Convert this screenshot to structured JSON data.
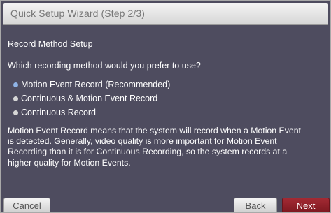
{
  "window": {
    "title": "Quick Setup Wizard (Step 2/3)"
  },
  "section": {
    "title": "Record Method Setup"
  },
  "question": "Which recording method would you prefer to use?",
  "options": [
    {
      "label": "Motion Event Record (Recommended)",
      "selected": true
    },
    {
      "label": "Continuous & Motion Event Record",
      "selected": false
    },
    {
      "label": "Continuous Record",
      "selected": false
    }
  ],
  "description": {
    "lines": [
      "Motion Event Record means that the system will record when a Motion Event",
      "is detected. Generally, video quality is more important for Motion Event",
      "Recording than it is for Continuous Recording, so the system records at a",
      "higher quality for Motion Events."
    ]
  },
  "buttons": {
    "cancel": "Cancel",
    "back": "Back",
    "next": "Next"
  },
  "colors": {
    "background": "#4e4c5f",
    "selected_radio": "#8fb3e6",
    "next_button": "#8f2029"
  }
}
